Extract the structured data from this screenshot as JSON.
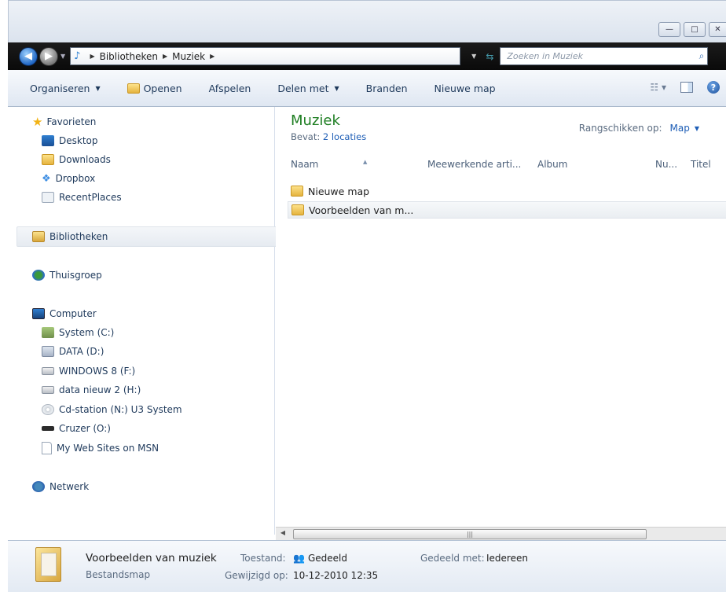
{
  "window": {
    "controls": [
      "—",
      "□",
      "✕"
    ]
  },
  "address": {
    "crumbs": [
      "Bibliotheken",
      "Muziek"
    ],
    "search_placeholder": "Zoeken in Muziek"
  },
  "toolbar": {
    "organize": "Organiseren",
    "open": "Openen",
    "play": "Afspelen",
    "share": "Delen met",
    "burn": "Branden",
    "new_folder": "Nieuwe map"
  },
  "nav": {
    "favorites": {
      "label": "Favorieten",
      "items": [
        "Desktop",
        "Downloads",
        "Dropbox",
        "RecentPlaces"
      ]
    },
    "libraries": "Bibliotheken",
    "homegroup": "Thuisgroep",
    "computer": {
      "label": "Computer",
      "items": [
        "System (C:)",
        "DATA (D:)",
        "WINDOWS 8 (F:)",
        "data nieuw 2 (H:)",
        "Cd-station (N:) U3 System",
        "Cruzer (O:)",
        "My Web Sites on MSN"
      ]
    },
    "network": "Netwerk"
  },
  "content": {
    "title": "Muziek",
    "contains_label": "Bevat:",
    "contains_link": "2 locaties",
    "arrange_label": "Rangschikken op:",
    "arrange_value": "Map",
    "columns": [
      "Naam",
      "Meewerkende arti...",
      "Album",
      "Nu...",
      "Titel"
    ],
    "rows": [
      "Nieuwe map",
      "Voorbeelden van m..."
    ]
  },
  "details": {
    "name": "Voorbeelden van muziek",
    "type": "Bestandsmap",
    "state_label": "Toestand:",
    "state_value": "Gedeeld",
    "shared_label": "Gedeeld met:",
    "shared_value": "Iedereen",
    "modified_label": "Gewijzigd op:",
    "modified_value": "10-12-2010 12:35"
  }
}
